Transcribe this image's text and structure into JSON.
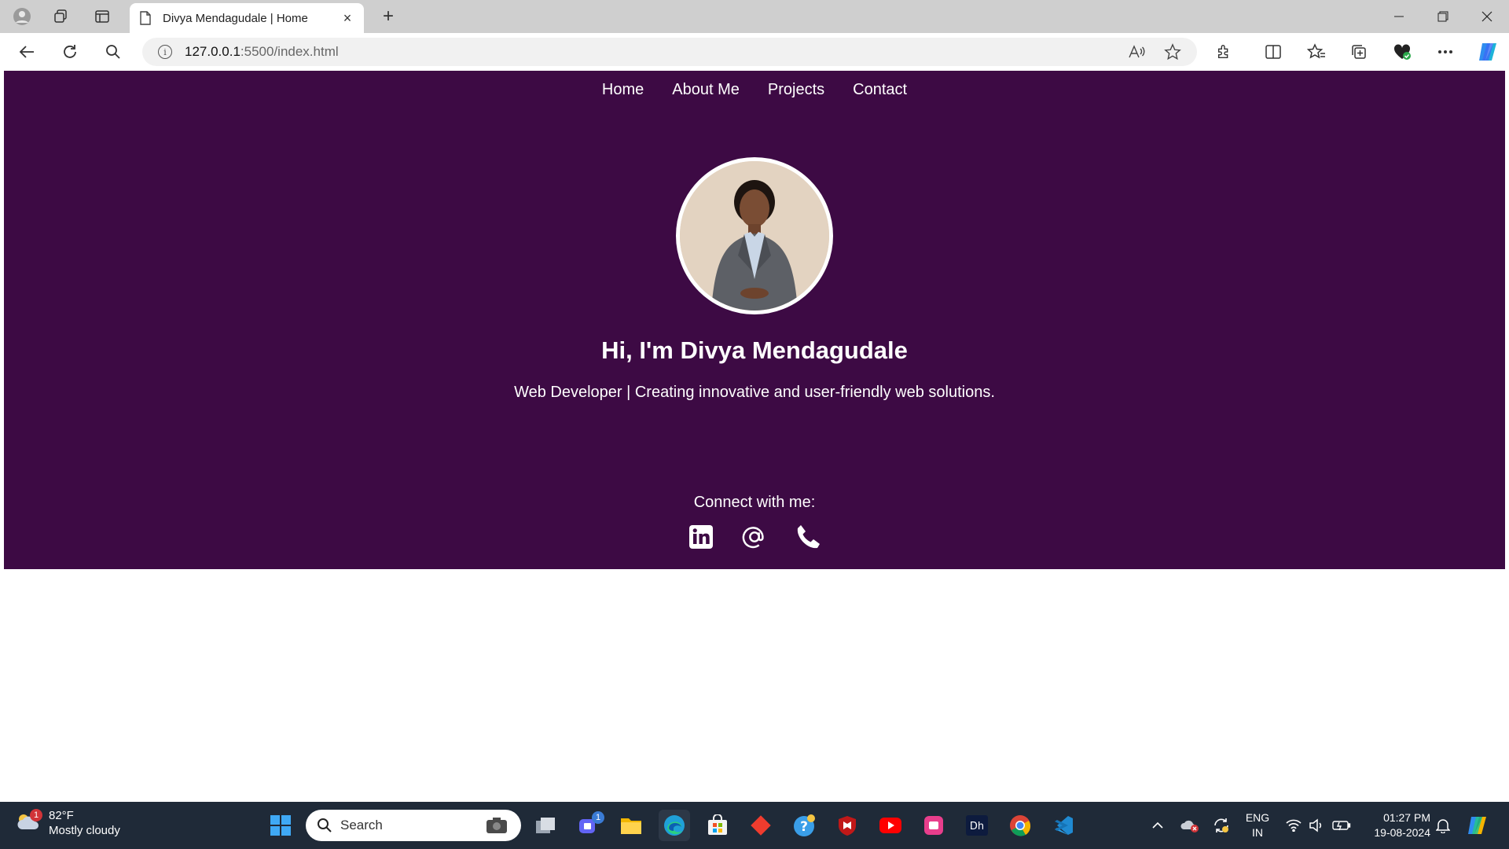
{
  "browser": {
    "tab_title": "Divya Mendagudale | Home",
    "url_host": "127.0.0.1",
    "url_path": ":5500/index.html"
  },
  "page": {
    "nav": [
      "Home",
      "About Me",
      "Projects",
      "Contact"
    ],
    "heading": "Hi, I'm Divya Mendagudale",
    "tagline": "Web Developer | Creating innovative and user-friendly web solutions.",
    "connect_label": "Connect with me:",
    "socials": [
      "linkedin-icon",
      "at-icon",
      "phone-icon"
    ],
    "colors": {
      "hero_bg": "#3d0a44",
      "text": "#ffffff"
    }
  },
  "taskbar": {
    "weather_temp": "82°F",
    "weather_desc": "Mostly cloudy",
    "weather_badge": "1",
    "search_placeholder": "Search",
    "teams_badge": "1",
    "lang_top": "ENG",
    "lang_bottom": "IN",
    "time": "01:27 PM",
    "date": "19-08-2024"
  }
}
